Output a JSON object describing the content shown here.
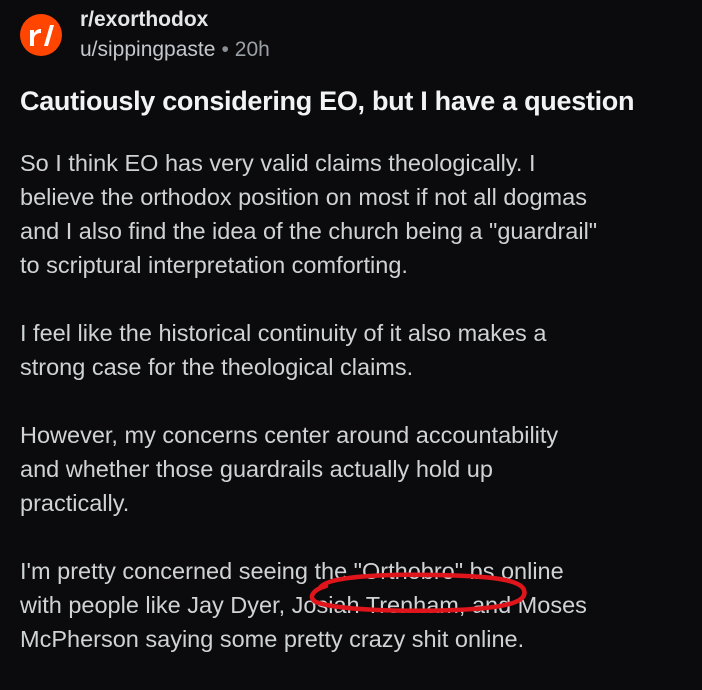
{
  "post": {
    "subreddit": "r/exorthodox",
    "author": "u/sippingpaste",
    "separator": "•",
    "age": "20h",
    "title": "Cautiously considering EO, but I have a question",
    "paragraphs": [
      {
        "lines": [
          "So I think EO has very valid claims theologically. I",
          "believe the orthodox position on most if not all dogmas",
          "and I also find the idea of the church being a \"guardrail\"",
          "to scriptural interpretation comforting."
        ]
      },
      {
        "lines": [
          "I feel like the historical continuity of it also makes a",
          "strong case for the theological claims."
        ]
      },
      {
        "lines": [
          "However, my concerns center around accountability",
          "and whether those guardrails actually hold up",
          "practically."
        ]
      },
      {
        "lines": [
          "I'm pretty concerned seeing the \"Orthobro\" bs online",
          "with people like Jay Dyer, Josiah Trenham, and Moses",
          "McPherson saying some pretty crazy shit online."
        ]
      }
    ]
  },
  "icons": {
    "avatar": "reddit-subreddit-icon"
  },
  "colors": {
    "background": "#0b0b0d",
    "avatar_bg": "#ff4500",
    "annotation_circle": "#e0151b"
  }
}
